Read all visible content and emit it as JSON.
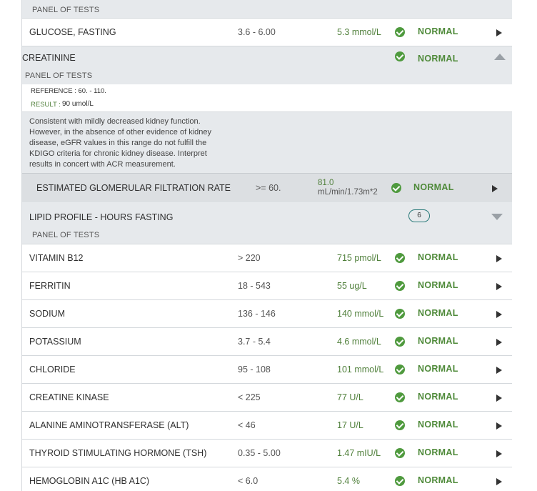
{
  "top_section": {
    "panel_label": "PANEL OF TESTS"
  },
  "glucose": {
    "name": "GLUCOSE, FASTING",
    "ref": "3.6 - 6.00",
    "result": "5.3 mmol/L",
    "status": "NORMAL"
  },
  "creatinine": {
    "name": "CREATININE",
    "status": "NORMAL",
    "panel_label": "PANEL OF TESTS",
    "reference": "REFERENCE : 60. - 110.",
    "result_label": "RESULT :",
    "result_value": "90 umol/L",
    "note": "Consistent with mildly decreased kidney function. However, in the absence of other evidence of kidney disease, eGFR values in this range do not fulfill the KDIGO criteria for chronic kidney disease. Interpret results in concert with ACR measurement.",
    "egfr": {
      "name": "ESTIMATED GLOMERULAR FILTRATION RATE",
      "ref": ">= 60.",
      "result_value": "81.0",
      "result_unit": "mL/min/1.73m*2",
      "status": "NORMAL"
    }
  },
  "lipid": {
    "name": "LIPID PROFILE - HOURS FASTING",
    "count": "6",
    "panel_label": "PANEL OF TESTS"
  },
  "tests": [
    {
      "name": "VITAMIN B12",
      "ref": "> 220",
      "result": "715 pmol/L",
      "status": "NORMAL"
    },
    {
      "name": "FERRITIN",
      "ref": "18 - 543",
      "result": "55 ug/L",
      "status": "NORMAL"
    },
    {
      "name": "SODIUM",
      "ref": "136 - 146",
      "result": "140 mmol/L",
      "status": "NORMAL"
    },
    {
      "name": "POTASSIUM",
      "ref": "3.7 - 5.4",
      "result": "4.6 mmol/L",
      "status": "NORMAL"
    },
    {
      "name": "CHLORIDE",
      "ref": "95 - 108",
      "result": "101 mmol/L",
      "status": "NORMAL"
    },
    {
      "name": "CREATINE KINASE",
      "ref": "< 225",
      "result": "77 U/L",
      "status": "NORMAL"
    },
    {
      "name": "ALANINE AMINOTRANSFERASE (ALT)",
      "ref": "< 46",
      "result": "17 U/L",
      "status": "NORMAL"
    },
    {
      "name": "THYROID STIMULATING HORMONE (TSH)",
      "ref": "0.35 - 5.00",
      "result": "1.47 mIU/L",
      "status": "NORMAL"
    },
    {
      "name": "HEMOGLOBIN A1C (HB A1C)",
      "ref": "< 6.0",
      "result": "5.4 %",
      "status": "NORMAL"
    }
  ],
  "colors": {
    "normal": "#4f8a3a",
    "check": "#4f9a3e",
    "badge_border": "#2a7a7a",
    "gray_bg": "#e6e9ec"
  }
}
